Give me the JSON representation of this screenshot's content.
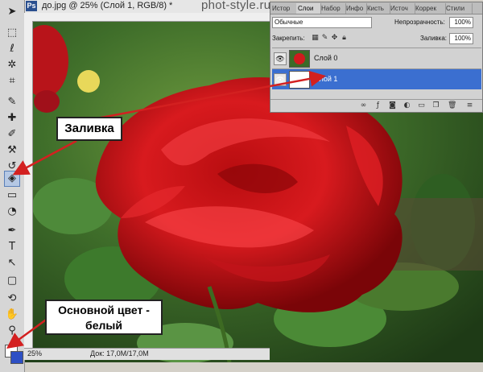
{
  "watermark": "phot-style.ru",
  "window": {
    "app_icon": "Ps",
    "title": "до.jpg @ 25% (Слой 1, RGB/8) *"
  },
  "panel": {
    "tabs": [
      "Истор",
      "Слои",
      "Набор",
      "Инфо",
      "Кисть",
      "Источ",
      "Коррек",
      "Стили"
    ],
    "active_tab": "Слои",
    "blend_mode": "Обычные",
    "opacity_label": "Непрозрачность:",
    "opacity_value": "100%",
    "lock_label": "Закрепить:",
    "fill_label": "Заливка:",
    "fill_value": "100%",
    "layers": [
      {
        "name": "Слой 0",
        "selected": false,
        "thumb": "rose-photo"
      },
      {
        "name": "Слой 1",
        "selected": true,
        "thumb": "white-fill"
      }
    ]
  },
  "status": {
    "zoom": "25%",
    "doc": "Док: 17,0M/17,0M"
  },
  "callouts": {
    "fill": "Заливка",
    "foreground": "Основной цвет - белый"
  },
  "colors": {
    "foreground": "#ffffff",
    "background": "#2d4fc4",
    "selected_layer": "#3b6fd0",
    "arrow": "#d32020"
  }
}
